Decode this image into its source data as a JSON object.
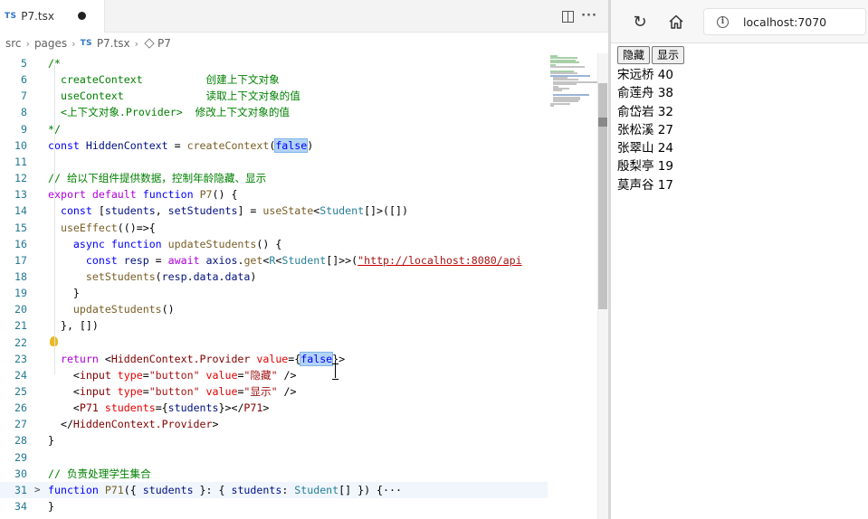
{
  "editor": {
    "tab": {
      "lang_badge": "TS",
      "filename": "P7.tsx"
    },
    "breadcrumb": {
      "parts": [
        "src",
        "pages",
        "TS",
        "P7.tsx",
        "P7"
      ]
    },
    "lines": [
      {
        "n": "5",
        "html": "/*"
      },
      {
        "n": "6",
        "html": "  createContext          创建上下文对象"
      },
      {
        "n": "7",
        "html": "  useContext             读取上下文对象的值"
      },
      {
        "n": "8",
        "html": "  <上下文对象.Provider>  修改上下文对象的值"
      },
      {
        "n": "9",
        "html": "*/"
      },
      {
        "n": "10",
        "html": "const HiddenContext = createContext(false)"
      },
      {
        "n": "11",
        "html": ""
      },
      {
        "n": "12",
        "html": "// 给以下组件提供数据，控制年龄隐藏、显示"
      },
      {
        "n": "13",
        "html": "export default function P7() {"
      },
      {
        "n": "14",
        "html": "  const [students, setStudents] = useState<Student[]>([])"
      },
      {
        "n": "15",
        "html": "  useEffect(()=>{"
      },
      {
        "n": "16",
        "html": "    async function updateStudents() {"
      },
      {
        "n": "17",
        "html": "      const resp = await axios.get<R<Student[]>>(\"http://localhost:8080/api"
      },
      {
        "n": "18",
        "html": "      setStudents(resp.data.data)"
      },
      {
        "n": "19",
        "html": "    }"
      },
      {
        "n": "20",
        "html": "    updateStudents()"
      },
      {
        "n": "21",
        "html": "  }, [])"
      },
      {
        "n": "22",
        "html": ""
      },
      {
        "n": "23",
        "html": "  return <HiddenContext.Provider value={false}>"
      },
      {
        "n": "24",
        "html": "    <input type=\"button\" value=\"隐藏\" />"
      },
      {
        "n": "25",
        "html": "    <input type=\"button\" value=\"显示\" />"
      },
      {
        "n": "26",
        "html": "    <P71 students={students}></P71>"
      },
      {
        "n": "27",
        "html": "  </HiddenContext.Provider>"
      },
      {
        "n": "28",
        "html": "}"
      },
      {
        "n": "29",
        "html": ""
      },
      {
        "n": "30",
        "html": "// 负责处理学生集合"
      },
      {
        "n": "31",
        "html": "function P71({ students }: { students: Student[] }) {···"
      },
      {
        "n": "34",
        "html": "}"
      }
    ]
  },
  "browser": {
    "address": "localhost:7070",
    "buttons": [
      "隐藏",
      "显示"
    ],
    "students": [
      "宋远桥 40",
      "俞莲舟 38",
      "俞岱岩 32",
      "张松溪 27",
      "张翠山 24",
      "殷梨亭 19",
      "莫声谷 17"
    ]
  },
  "colors": {
    "keyword": "#0000ff",
    "control": "#af00db",
    "function": "#795e26",
    "string": "#a31515",
    "comment": "#008000",
    "tag": "#800000",
    "attribute": "#e50000",
    "type": "#267f99",
    "variable": "#001080",
    "line_number": "#237893",
    "highlight": "#b3d4f5"
  },
  "icons": [
    "split-editor-icon",
    "more-actions-icon",
    "symbol-method-icon",
    "lightbulb-icon",
    "fold-chevron-icon",
    "refresh-icon",
    "home-icon",
    "info-icon"
  ]
}
